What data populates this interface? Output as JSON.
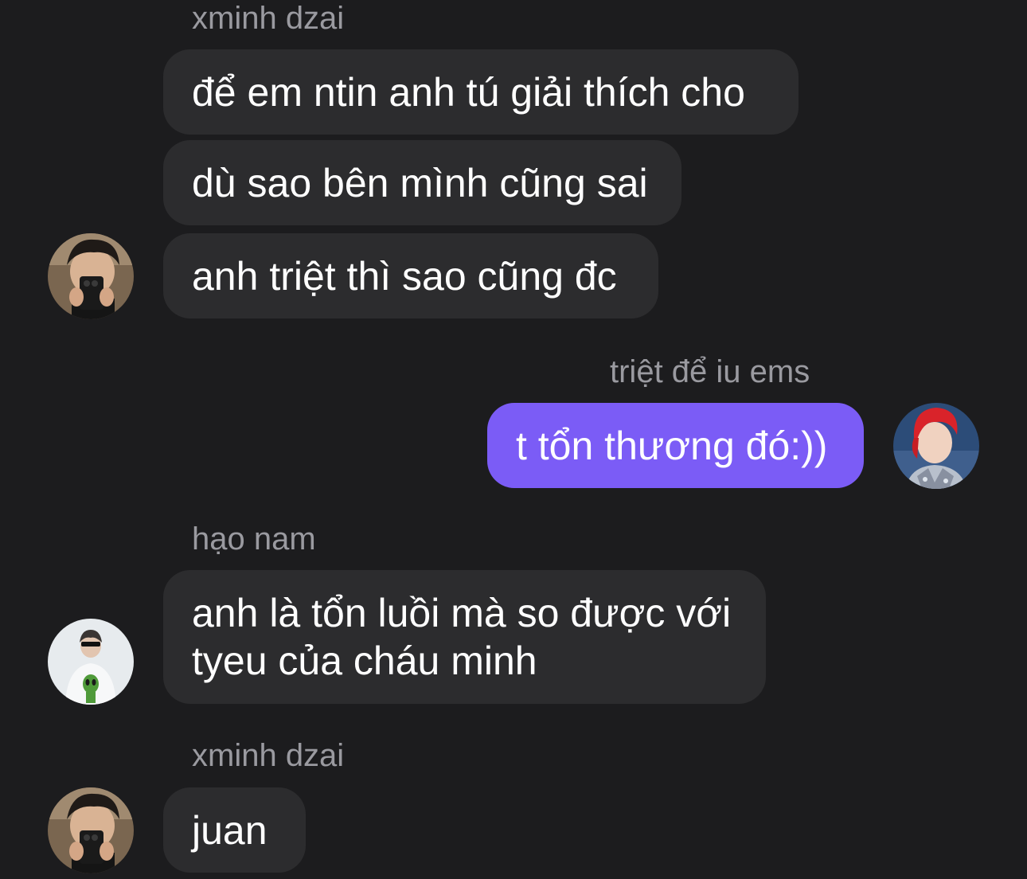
{
  "messages": [
    {
      "sender": "xminh dzai",
      "bubbles": [
        "để em ntin anh tú giải thích cho",
        "dù sao bên mình cũng sai",
        "anh triệt thì sao cũng đc"
      ],
      "avatar": "avatar-mirror-selfie"
    },
    {
      "sender": "triệt để iu ems",
      "bubbles": [
        "t tổn thương đó:))"
      ],
      "avatar": "avatar-red-hair",
      "outgoing": true
    },
    {
      "sender": "hạo nam",
      "bubbles": [
        [
          "anh là tổn luồi mà so được với",
          "tyeu của cháu minh"
        ]
      ],
      "avatar": "avatar-alien-shirt"
    },
    {
      "sender": "xminh dzai",
      "bubbles": [
        "juan"
      ],
      "avatar": "avatar-mirror-selfie"
    }
  ],
  "colors": {
    "background": "#1c1c1e",
    "incoming_bubble": "#2c2c2e",
    "outgoing_bubble": "#7b5cf6",
    "sender_name": "#9a9aa0",
    "text": "#ffffff"
  }
}
